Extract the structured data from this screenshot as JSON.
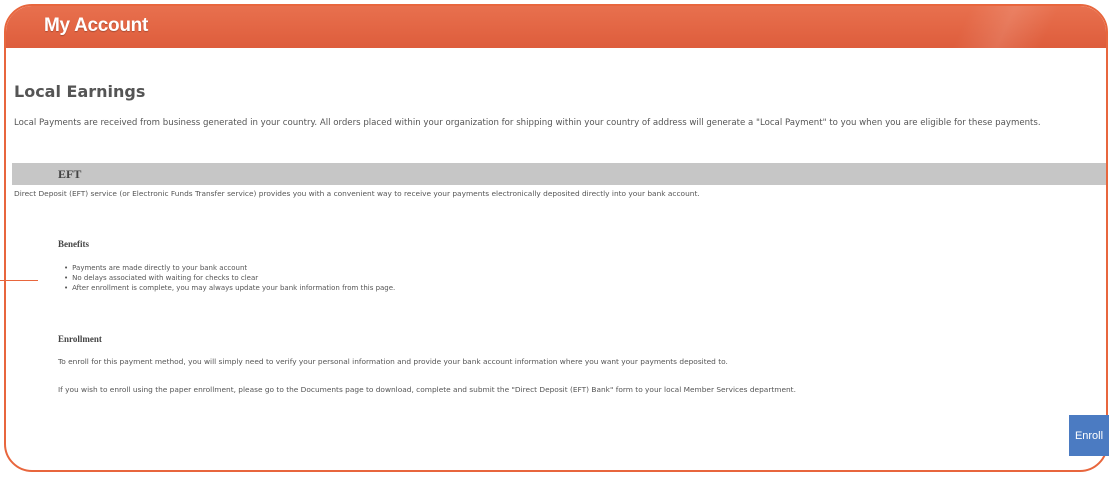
{
  "header": {
    "title": "My Account"
  },
  "page": {
    "section_title": "Local Earnings",
    "intro": "Local Payments are received from business generated in your country. All orders placed within your organization for shipping within your country of address will generate a \"Local Payment\" to you when you are eligible for these payments."
  },
  "eft": {
    "label": "EFT",
    "description": "Direct Deposit (EFT) service (or Electronic Funds Transfer service) provides you with a convenient way to receive your payments electronically deposited directly into your bank account."
  },
  "benefits": {
    "heading": "Benefits",
    "items": [
      "Payments are made directly to your bank account",
      "No delays associated with waiting for checks to clear",
      "After enrollment is complete, you may always update your bank information from this page."
    ]
  },
  "enrollment": {
    "heading": "Enrollment",
    "text1": "To enroll for this payment method, you will simply need to verify your personal information and provide your bank account information where you want your payments deposited to.",
    "text2": "If you wish to enroll using the paper enrollment, please go to the Documents page to download, complete and submit the \"Direct Deposit (EFT) Bank\" form to your local Member Services department.",
    "button_label": "Enroll"
  },
  "colors": {
    "header": "#e0603f",
    "border": "#e8663d",
    "section_bar": "#c6c6c6",
    "button": "#4b7bc2"
  }
}
